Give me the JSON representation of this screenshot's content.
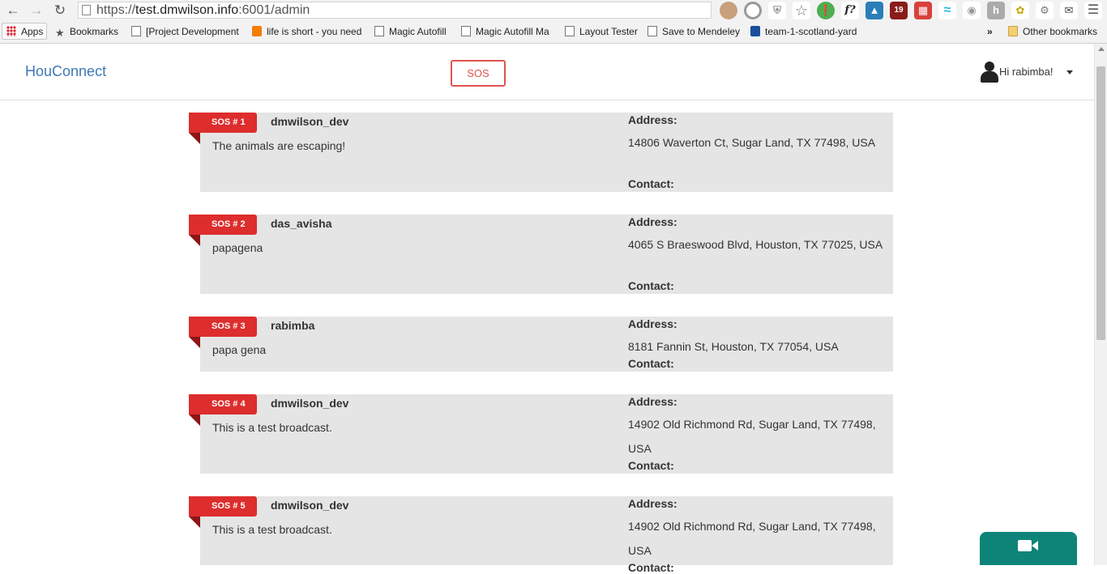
{
  "browser": {
    "url_prefix": "https://",
    "url_host": "test.dmwilson.info",
    "url_rest": ":6001/admin",
    "bookmarks": [
      {
        "label": "Apps",
        "icon": "apps-grid-icon"
      },
      {
        "label": "Bookmarks",
        "icon": "star-icon"
      },
      {
        "label": "[Project Development",
        "icon": "page-icon"
      },
      {
        "label": "life is short - you need",
        "icon": "blogger-icon"
      },
      {
        "label": "Magic Autofill",
        "icon": "page-icon"
      },
      {
        "label": "Magic Autofill Ma",
        "icon": "page-icon"
      },
      {
        "label": "Layout Tester",
        "icon": "page-icon"
      },
      {
        "label": "Save to Mendeley",
        "icon": "page-icon"
      },
      {
        "label": "team-1-scotland-yard",
        "icon": "mendeley-icon"
      },
      {
        "label": "»",
        "icon": "overflow-chevron-icon"
      },
      {
        "label": "Other bookmarks",
        "icon": "folder-icon"
      }
    ],
    "extension_badge": "19"
  },
  "header": {
    "brand": "HouConnect",
    "sos_button": "SOS",
    "greeting": "Hi rabimba!"
  },
  "sos_list": [
    {
      "tag": "SOS # 1",
      "user": "dmwilson_dev",
      "message": "The animals are escaping!",
      "address_label": "Address:",
      "address": "14806 Waverton Ct, Sugar Land, TX 77498, USA",
      "contact_label": "Contact:"
    },
    {
      "tag": "SOS # 2",
      "user": "das_avisha",
      "message": "papagena",
      "address_label": "Address:",
      "address": "4065 S Braeswood Blvd, Houston, TX 77025, USA",
      "contact_label": "Contact:"
    },
    {
      "tag": "SOS # 3",
      "user": "rabimba",
      "message": "papa gena",
      "address_label": "Address:",
      "address": "8181 Fannin St, Houston, TX 77054, USA",
      "contact_label": "Contact:"
    },
    {
      "tag": "SOS # 4",
      "user": "dmwilson_dev",
      "message": "This is a test broadcast.",
      "address_label": "Address:",
      "address": "14902 Old Richmond Rd, Sugar Land, TX 77498, USA",
      "contact_label": "Contact:"
    },
    {
      "tag": "SOS # 5",
      "user": "dmwilson_dev",
      "message": "This is a test broadcast.",
      "address_label": "Address:",
      "address": "14902 Old Richmond Rd, Sugar Land, TX 77498, USA",
      "contact_label": "Contact:"
    }
  ],
  "colors": {
    "brand": "#3f79b5",
    "sos_red": "#dd2d2d",
    "card_bg": "#e5e5e5",
    "video_teal": "#0e8479"
  }
}
